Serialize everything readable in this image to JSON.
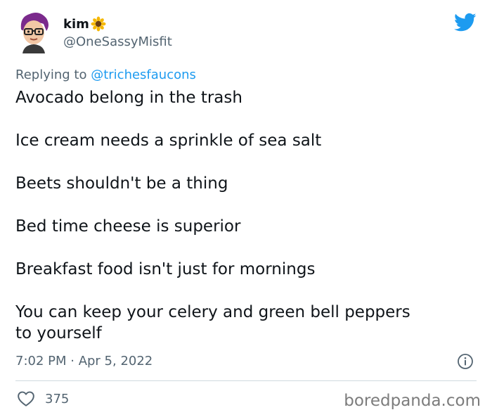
{
  "tweet": {
    "author": {
      "display_name": "kim",
      "emoji": "sunflower",
      "handle": "@OneSassyMisfit",
      "avatar_icon": "bitmoji-avatar"
    },
    "brand_icon": "twitter-bird-icon",
    "reply_prefix": "Replying to",
    "reply_to": "@trichesfaucons",
    "lines": [
      "Avocado belong in the trash",
      "Ice cream needs a sprinkle of sea salt",
      "Beets shouldn't be a thing",
      "Bed time cheese is superior",
      "Breakfast food isn't just for mornings",
      "You can keep your celery and green bell peppers",
      "to yourself"
    ],
    "timestamp": "7:02 PM · Apr 5, 2022",
    "likes_count": "375"
  },
  "watermark": "boredpanda.com",
  "colors": {
    "brand_blue": "#1d9bf0",
    "text_primary": "#0f1419",
    "text_secondary": "#536471"
  }
}
